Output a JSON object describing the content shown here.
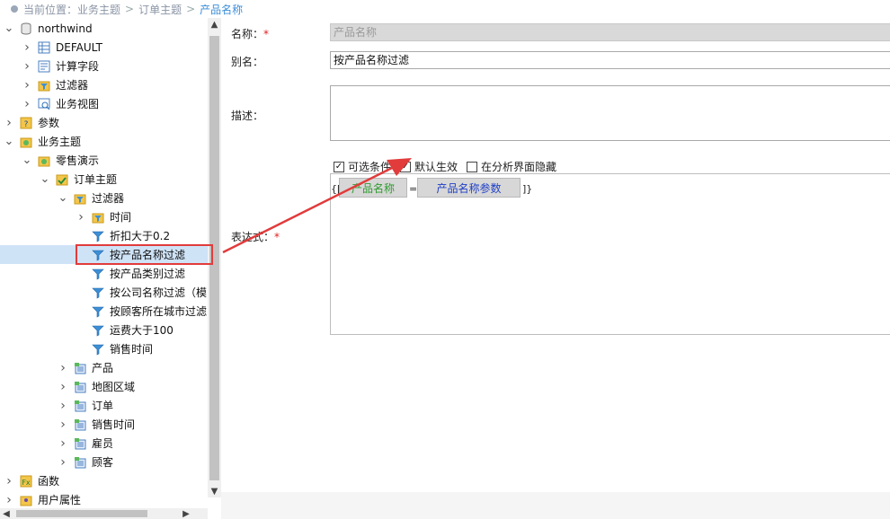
{
  "breadcrumb": {
    "prefix": "当前位置：",
    "items": [
      "业务主题",
      "订单主题"
    ],
    "separator": ">",
    "current": "产品名称"
  },
  "tree": {
    "items": [
      {
        "label": "northwind",
        "level": 0,
        "expanded": true,
        "icon": "database-icon"
      },
      {
        "label": "DEFAULT",
        "level": 1,
        "expanded": false,
        "icon": "table-icon"
      },
      {
        "label": "计算字段",
        "level": 1,
        "expanded": false,
        "icon": "calc-field-icon"
      },
      {
        "label": "过滤器",
        "level": 1,
        "expanded": false,
        "icon": "filter-folder-icon"
      },
      {
        "label": "业务视图",
        "level": 1,
        "expanded": false,
        "icon": "business-view-icon"
      },
      {
        "label": "参数",
        "level": 0,
        "expanded": false,
        "icon": "param-icon"
      },
      {
        "label": "业务主题",
        "level": 0,
        "expanded": true,
        "icon": "topic-folder-icon"
      },
      {
        "label": "零售演示",
        "level": 1,
        "expanded": true,
        "icon": "topic-folder-icon"
      },
      {
        "label": "订单主题",
        "level": 2,
        "expanded": true,
        "icon": "topic-check-icon"
      },
      {
        "label": "过滤器",
        "level": 3,
        "expanded": true,
        "icon": "filter-folder-icon"
      },
      {
        "label": "时间",
        "level": 4,
        "expanded": false,
        "icon": "filter-folder-icon"
      },
      {
        "label": "折扣大于0.2",
        "level": 4,
        "leaf": true,
        "icon": "filter-icon"
      },
      {
        "label": "按产品名称过滤",
        "level": 4,
        "leaf": true,
        "icon": "filter-icon",
        "selected": true
      },
      {
        "label": "按产品类别过滤",
        "level": 4,
        "leaf": true,
        "icon": "filter-icon"
      },
      {
        "label": "按公司名称过滤（模",
        "level": 4,
        "leaf": true,
        "icon": "filter-icon"
      },
      {
        "label": "按顾客所在城市过滤",
        "level": 4,
        "leaf": true,
        "icon": "filter-icon"
      },
      {
        "label": "运费大于100",
        "level": 4,
        "leaf": true,
        "icon": "filter-icon"
      },
      {
        "label": "销售时间",
        "level": 4,
        "leaf": true,
        "icon": "filter-icon"
      },
      {
        "label": "产品",
        "level": 3,
        "expanded": false,
        "icon": "dimension-icon"
      },
      {
        "label": "地图区域",
        "level": 3,
        "expanded": false,
        "icon": "dimension-icon"
      },
      {
        "label": "订单",
        "level": 3,
        "expanded": false,
        "icon": "dimension-icon"
      },
      {
        "label": "销售时间",
        "level": 3,
        "expanded": false,
        "icon": "dimension-icon"
      },
      {
        "label": "雇员",
        "level": 3,
        "expanded": false,
        "icon": "dimension-icon"
      },
      {
        "label": "顾客",
        "level": 3,
        "expanded": false,
        "icon": "dimension-icon"
      },
      {
        "label": "函数",
        "level": 0,
        "expanded": false,
        "icon": "function-icon"
      },
      {
        "label": "用户属性",
        "level": 0,
        "expanded": false,
        "icon": "user-attr-icon"
      }
    ]
  },
  "form": {
    "name_label": "名称：",
    "name_required": "*",
    "name_value": "产品名称",
    "alias_label": "别名：",
    "alias_value": "按产品名称过滤",
    "desc_label": "描述：",
    "desc_value": "",
    "expr_label": "表达式：",
    "expr_required": "*",
    "checkboxes": [
      {
        "label": "可选条件",
        "checked": true
      },
      {
        "label": "默认生效",
        "checked": true
      },
      {
        "label": "在分析界面隐藏",
        "checked": false
      }
    ],
    "expr_open": "{[",
    "expr_field": "产品名称",
    "expr_op": "=",
    "expr_param": "产品名称参数",
    "expr_close": "]}"
  },
  "colors": {
    "accent": "#3b8ed8",
    "selected_row": "#cfe3f7",
    "annotation": "#e23b3b",
    "field_token_text": "#2e9b2e",
    "param_token_text": "#1f3fc7",
    "required": "#e02020"
  }
}
